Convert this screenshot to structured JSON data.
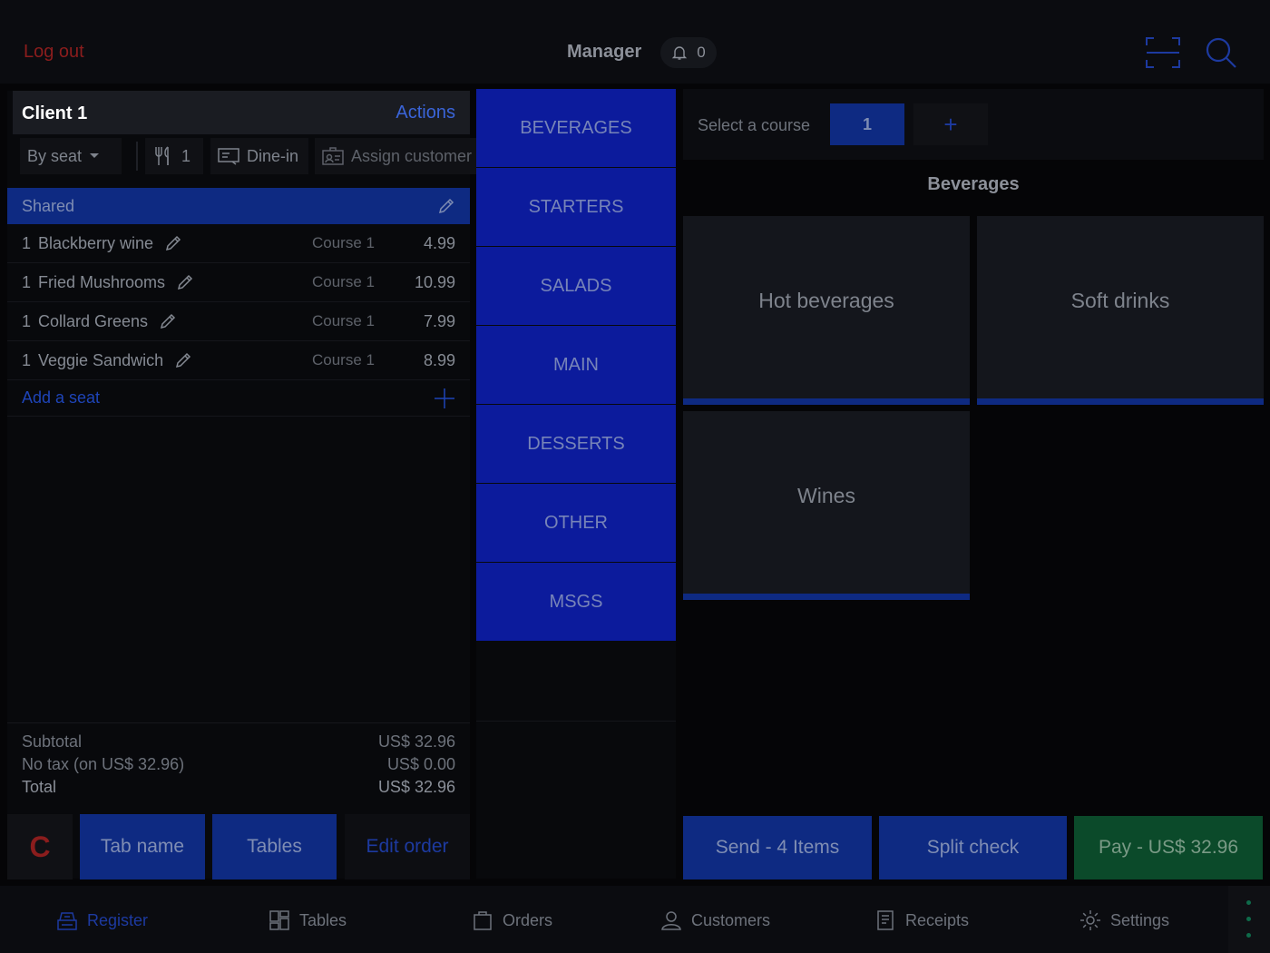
{
  "header": {
    "logout": "Log out",
    "user": "Manager",
    "notifications": "0"
  },
  "client": {
    "name": "Client 1",
    "actions": "Actions"
  },
  "tools": {
    "mode": "By seat",
    "guests": "1",
    "service": "Dine-in",
    "assign": "Assign customer"
  },
  "order": {
    "section": "Shared",
    "items": [
      {
        "qty": "1",
        "name": "Blackberry wine",
        "course": "Course 1",
        "price": "4.99"
      },
      {
        "qty": "1",
        "name": "Fried Mushrooms",
        "course": "Course 1",
        "price": "10.99"
      },
      {
        "qty": "1",
        "name": "Collard Greens",
        "course": "Course 1",
        "price": "7.99"
      },
      {
        "qty": "1",
        "name": "Veggie Sandwich",
        "course": "Course 1",
        "price": "8.99"
      }
    ],
    "add_seat": "Add a seat"
  },
  "totals": {
    "subtotal_label": "Subtotal",
    "subtotal_value": "US$ 32.96",
    "tax_label": "No tax (on US$ 32.96)",
    "tax_value": "US$ 0.00",
    "total_label": "Total",
    "total_value": "US$ 32.96"
  },
  "left_buttons": {
    "clear": "C",
    "tab_name": "Tab name",
    "tables": "Tables",
    "edit_order": "Edit order"
  },
  "categories": [
    "BEVERAGES",
    "STARTERS",
    "SALADS",
    "MAIN",
    "DESSERTS",
    "OTHER",
    "MSGS"
  ],
  "course": {
    "label": "Select a course",
    "selected": "1",
    "add": "+"
  },
  "menu": {
    "title": "Beverages",
    "tiles": [
      "Hot beverages",
      "Soft drinks",
      "Wines"
    ]
  },
  "right_buttons": {
    "send": "Send - 4 Items",
    "split": "Split check",
    "pay": "Pay - US$ 32.96"
  },
  "nav": {
    "register": "Register",
    "tables": "Tables",
    "orders": "Orders",
    "customers": "Customers",
    "receipts": "Receipts",
    "settings": "Settings"
  },
  "colors": {
    "accent_blue": "#0e2a82",
    "category_blue": "#0c1b9c",
    "pay_green": "#0b4a2a",
    "logout_red": "#8b1d1d"
  }
}
